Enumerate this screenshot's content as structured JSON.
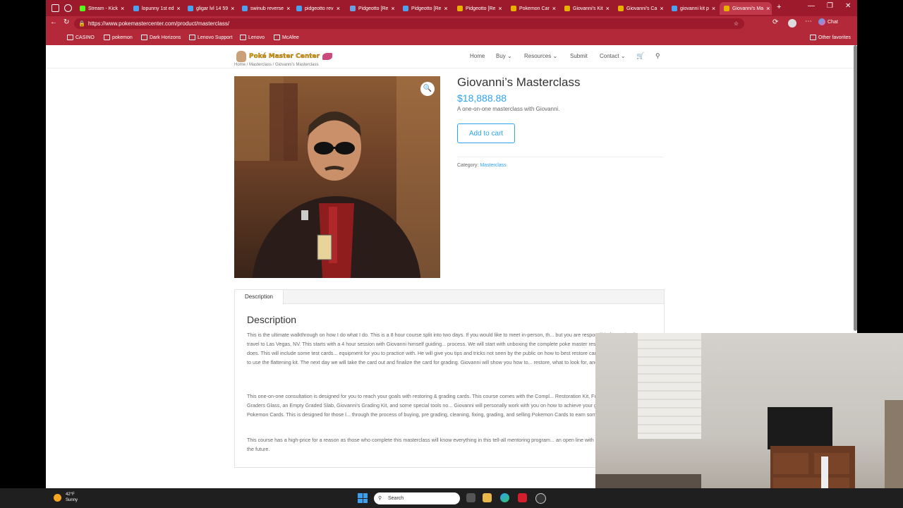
{
  "browser": {
    "tabs": [
      {
        "title": "Stream - Kick",
        "fav": "#53fc18"
      },
      {
        "title": "lopunny 1st ed",
        "fav": "#4aa3f0"
      },
      {
        "title": "gligar lvl 14 59",
        "fav": "#4aa3f0"
      },
      {
        "title": "swinub reverse",
        "fav": "#4aa3f0"
      },
      {
        "title": "pidgeotto rev",
        "fav": "#4aa3f0"
      },
      {
        "title": "Pidgeotto [Re",
        "fav": "#6aa0e0"
      },
      {
        "title": "Pidgeotto [Re",
        "fav": "#4aa3f0"
      },
      {
        "title": "Pidgeotto [Re",
        "fav": "#e8b100"
      },
      {
        "title": "Pokemon Car",
        "fav": "#e8b100"
      },
      {
        "title": "Giovanni's Kit",
        "fav": "#e8b100"
      },
      {
        "title": "Giovanni's Ca",
        "fav": "#e8b100"
      },
      {
        "title": "giovanni kit p",
        "fav": "#4aa3f0"
      },
      {
        "title": "Giovanni's Ma",
        "fav": "#e8b100"
      }
    ],
    "tab_close_glyph": "×",
    "new_tab_glyph": "+",
    "window_controls": [
      "—",
      "❐",
      "✕"
    ],
    "url": "https://www.pokemastercenter.com/product/masterclass/",
    "chat_label": "Chat",
    "bookmarks": [
      "CASINO",
      "pokemon",
      "Dark Horizons",
      "Lenovo Support",
      "Lenovo",
      "McAfee"
    ],
    "other_favorites": "Other favorites"
  },
  "site": {
    "logo_text": "Poké Master Center",
    "nav": [
      "Home",
      "Buy",
      "Resources",
      "Submit",
      "Contact"
    ],
    "breadcrumb": "Home / Masterclass / Giovanni's Masterclass"
  },
  "product": {
    "title": "Giovanni’s Masterclass",
    "price": "$18,888.88",
    "short_description": "A one-on-one masterclass with Giovanni.",
    "add_to_cart": "Add to cart",
    "category_label": "Category:",
    "category_value": "Masterclass"
  },
  "description": {
    "tab_label": "Description",
    "heading": "Description",
    "paragraphs": [
      "This is the ultimate walkthrough on how I do what I do. This is a 8 hour course split into two days. If you would like to meet in-person, th... but you are responsible for paying for your own travel to Las Vegas, NV. This starts with a 4 hour session with Giovanni himself guiding... process. We will start with unboxing the complete poke master restoration kit and what each kit does. This will include some test cards... equipment for you to practice with. He will give you tips and tricks not seen by the public on how to best restore cards. Towards the en... on how to use the flattening kit. The next day we will take the card out and finalize the card for grading. Giovanni will show you how to... restore, what to look for, and how to negotiate.",
      "This one-on-one consultation is designed for you to reach your goals with restoring & grading cards. This course comes with the Compl... Restoration Kit, Full Revive, 50 Vinyl Sheets, Graders Glass, an Empty Graded Slab, Giovanni's Grading Kit, and some special tools no... Giovanni will personally work with you on how to achieve your goals with restoring/grading Pokemon Cards. This is designed for those l... through the process of buying, pre grading, cleaning, fixing, grading, and selling Pokemon Cards to earn some extra income.",
      "This course has a high-price for a reason as those who complete this masterclass will know everything in this tell-all mentoring program... an open line with Giovanni if you need advice in the future."
    ]
  },
  "taskbar": {
    "temp": "42°F",
    "condition": "Sunny",
    "search_placeholder": "Search"
  },
  "colors": {
    "accent": "#2ea3f2",
    "tabbar": "#9c1a2b"
  }
}
